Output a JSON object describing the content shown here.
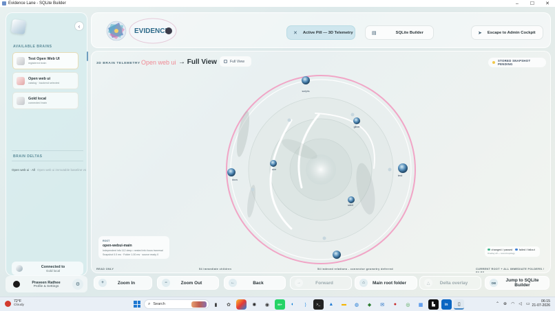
{
  "window": {
    "title": "Evidence Lane - SQLite Builder",
    "controls": [
      "–",
      "☐",
      "✕"
    ]
  },
  "sidebar": {
    "section_brains": "AVAILABLE BRAINS",
    "brains": [
      {
        "name": "Test Open Web UI",
        "sub": "registered brain"
      },
      {
        "name": "Open web ui",
        "sub": "catalog · backend selected"
      },
      {
        "name": "Gold local",
        "sub": "connected brain"
      }
    ],
    "section_deltas": "BRAIN DELTAS",
    "delta": {
      "label": "Open web ui · All",
      "extra": "Open web ui immutable baseline vs"
    },
    "connected": {
      "title": "Connected to",
      "sub": "Gold local"
    },
    "profile": {
      "name": "Praveen Rathee",
      "sub": "Profile & Settings"
    }
  },
  "topbar": {
    "logo_word": "EVIDENCE",
    "pills": [
      {
        "label": "Active Pill — 3D Telemetry",
        "icon": "telemetry-icon"
      },
      {
        "label": "SQLite Builder",
        "icon": "database-icon"
      },
      {
        "label": "Escape to Admin Cockpit",
        "icon": "send-icon"
      }
    ]
  },
  "main": {
    "header": {
      "label": "3D BRAIN TELEMETRY",
      "brain": "Open web ui",
      "view": "→ Full View",
      "fullview_button": "Full View"
    },
    "snapshot": "STORED SNAPSHOT PENDING",
    "nodes": [
      {
        "label": "scripts"
      },
      {
        "label": "gitnet"
      },
      {
        "label": "test"
      },
      {
        "label": "docs"
      },
      {
        "label": "core"
      },
      {
        "label": "sdnet"
      },
      {
        "label": ""
      }
    ],
    "node_card": {
      "kicker": "ROOT",
      "title": "open-webui-main",
      "line1": "Independent info 112 deep • nested info focus traversal",
      "line2": "Snapshot 0.0 ms · Folder 1.00 ms · source ready 0"
    },
    "legend": {
      "item1": "changed / passed",
      "item2": "failed / fallout",
      "sub": "Overlay off — record topology",
      "color1": "#43b58c",
      "color2": "#3e7fd6"
    },
    "footer": {
      "left": "READ ONLY",
      "mid1": "54 immediate children",
      "mid2": "54 indexed relations - connector geometry deferred",
      "right": "CURRENT ROOT + ALL IMMEDIATE FOLDERS / FILES"
    }
  },
  "toolbar": {
    "buttons": [
      {
        "label": "Zoom In",
        "icon": "+"
      },
      {
        "label": "Zoom Out",
        "icon": "−"
      },
      {
        "label": "Back",
        "icon": "←"
      },
      {
        "label": "Forward",
        "icon": "→"
      },
      {
        "label": "Main root folder",
        "icon": "⌂"
      },
      {
        "label": "Delta overlay",
        "icon": "△"
      },
      {
        "label": "Jump to SQLite Builder",
        "icon": "DB"
      }
    ]
  },
  "taskbar": {
    "weather": {
      "temp": "72°F",
      "desc": "Cloudy"
    },
    "search_placeholder": "Search",
    "badge": "99+",
    "clock": {
      "time": "06:15",
      "date": "21-07-2026"
    }
  }
}
